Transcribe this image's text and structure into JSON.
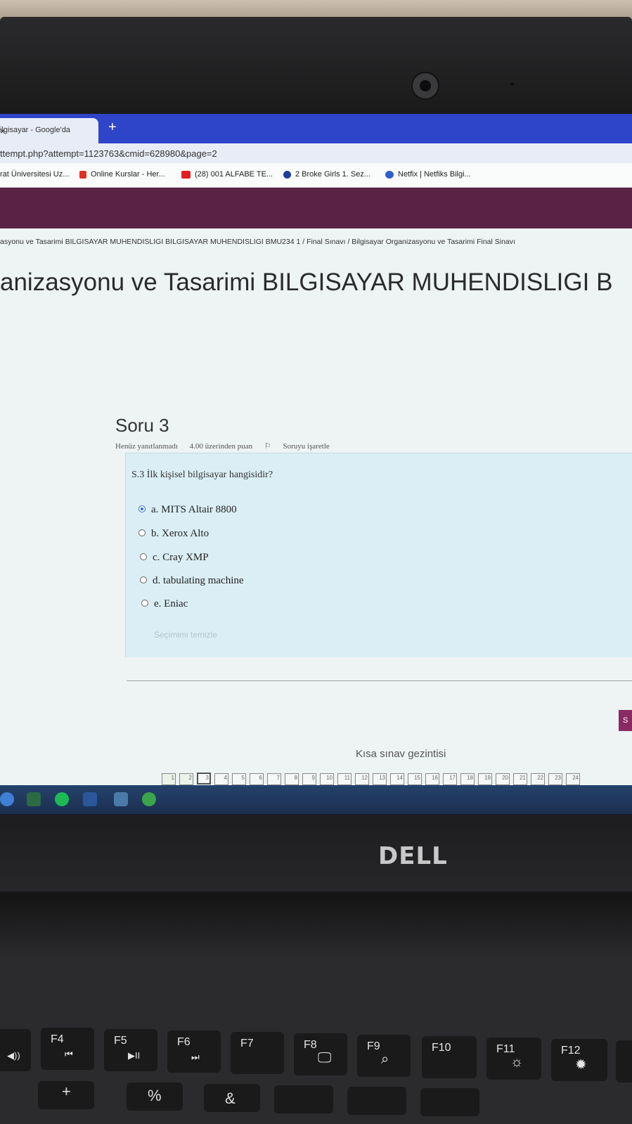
{
  "browser": {
    "tab_title": "ilgisayar - Google'da",
    "tab_close": "×",
    "new_tab": "+",
    "url": "ttempt.php?attempt=1123763&cmid=628980&page=2",
    "bookmarks": [
      {
        "label": "rat Üniversitesi Uz...",
        "icon": "university-icon",
        "color": "#dddddd"
      },
      {
        "label": "Online Kurslar - Her...",
        "icon": "udemy-icon",
        "color": "#e0321f"
      },
      {
        "label": "(28) 001 ALFABE TE...",
        "icon": "youtube-icon",
        "color": "#e02020"
      },
      {
        "label": "2 Broke Girls 1. Sez...",
        "icon": "dizi-icon",
        "color": "#1d3f9c"
      },
      {
        "label": "Netfix | Netfiks Bilgi...",
        "icon": "netfiks-icon",
        "color": "#2e60c9"
      }
    ]
  },
  "breadcrumb": "asyonu ve Tasarimi BILGISAYAR MUHENDISLIGI BILGISAYAR MUHENDISLIGI BMU234 1  /  Final Sınavı  /  Bilgisayar Organizasyonu ve Tasarimi Final Sinavı",
  "page_title": "anizasyonu ve Tasarimi BILGISAYAR MUHENDISLIGI B",
  "question": {
    "number": "Soru 3",
    "status": "Henüz yanıtlanmadı",
    "points": "4.00 üzerinden puan",
    "flag": "Soruyu işaretle",
    "text": "S.3 İlk kişisel bilgisayar hangisidir?",
    "options": [
      {
        "label": "a. MITS Altair 8800",
        "selected": true
      },
      {
        "label": "b.  Xerox Alto",
        "selected": false
      },
      {
        "label": "c. Cray XMP",
        "selected": false
      },
      {
        "label": "d. tabulating machine",
        "selected": false
      },
      {
        "label": "e. Eniac",
        "selected": false
      }
    ],
    "clear_choice": "Seçimimi temizle"
  },
  "next_button": "S",
  "quiz_nav": {
    "title": "Kısa sınav gezintisi",
    "pages": [
      "1",
      "2",
      "3",
      "4",
      "5",
      "6",
      "7",
      "8",
      "9",
      "10",
      "11",
      "12",
      "13",
      "14",
      "15",
      "16",
      "17",
      "18",
      "19",
      "20",
      "21",
      "22",
      "23",
      "24"
    ],
    "current": "3"
  },
  "taskbar_icons": [
    "file-icon",
    "spreadsheet-icon",
    "spotify-icon",
    "word-icon",
    "app-icon",
    "chat-icon"
  ],
  "laptop": {
    "brand": "DELL",
    "fn_keys": [
      {
        "label": "F4",
        "icon": "🔊"
      },
      {
        "label": "F5",
        "icon": "⏮"
      },
      {
        "label": "F6",
        "icon": "▶II"
      },
      {
        "label": "F7",
        "icon": "⏭"
      },
      {
        "label": "F8",
        "icon": "🖵"
      },
      {
        "label": "F9",
        "icon": "⌕"
      },
      {
        "label": "F10",
        "icon": ""
      },
      {
        "label": "F11",
        "icon": "☼"
      },
      {
        "label": "F12",
        "icon": "✹"
      }
    ],
    "row2_glyphs": [
      "+",
      "%",
      "&"
    ]
  }
}
